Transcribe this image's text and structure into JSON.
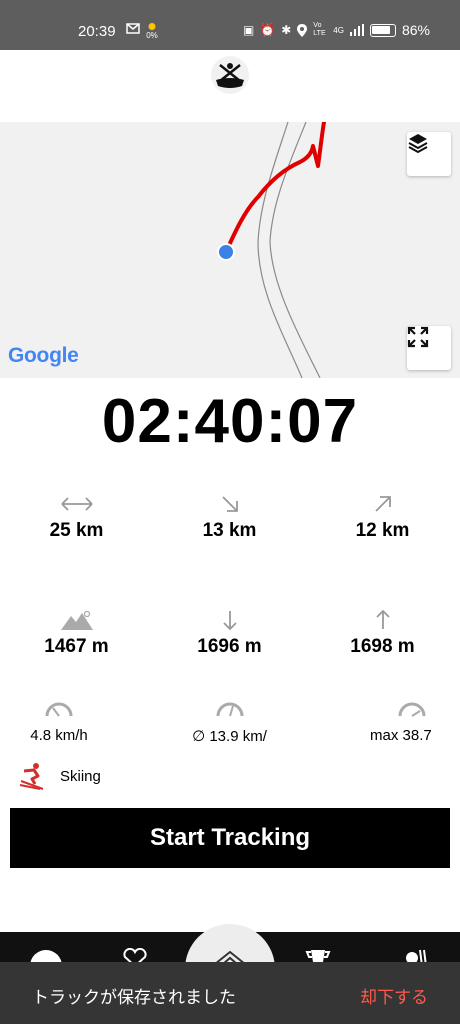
{
  "status_bar": {
    "time": "20:39",
    "battery_percent": "86%",
    "signal_label": "4G",
    "volte_label": "Vo LTE",
    "weather_value": "0%"
  },
  "map": {
    "provider_label": "Google"
  },
  "timer": {
    "elapsed": "02:40:07"
  },
  "stats": {
    "distance": "25 km",
    "downhill_distance": "13 km",
    "uphill_distance": "12 km",
    "altitude": "1467 m",
    "descent": "1696 m",
    "ascent": "1698 m",
    "current_speed": "4.8 km/h",
    "avg_speed": "∅ 13.9 km/",
    "max_speed": "max 38.7"
  },
  "activity": {
    "label": "Skiing"
  },
  "start_button": {
    "label": "Start Tracking"
  },
  "snackbar": {
    "message": "トラックが保存されました",
    "action": "却下する"
  },
  "colors": {
    "track": "#e00000",
    "location_dot": "#3b82e6",
    "snackbar_action": "#ff5a4c"
  }
}
